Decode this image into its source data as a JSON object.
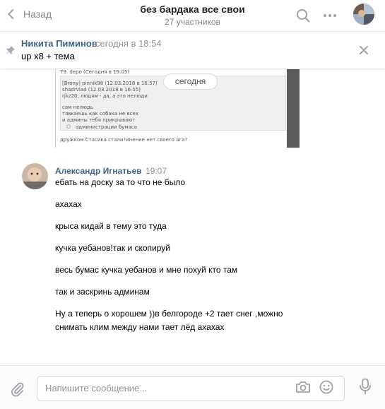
{
  "header": {
    "back_label": "Назад",
    "title": "без бардака все свои",
    "subtitle": "27 участников"
  },
  "pinned": {
    "author": "Никита Пиминов",
    "time": "сегодня в 18:54",
    "text": "up x8 + тема"
  },
  "attachment": {
    "lines": [
      "79. depo (Сегодня в 19:05)",
      "[Brony] pinnik98 (12.03.2018 в 16:57)",
      "shadrvlad (12.03.2018 в 16:55)",
      "rjkz20, людям - да, а это нелюди",
      "сам нелюдь",
      "тявкаешь как собака не всех",
      "и админы тебя прикрывают",
      "администрации бумаса",
      "дружком Стасика стали?инение нет своего ага?"
    ]
  },
  "date_divider": "сегодня",
  "message": {
    "author": "Александр Игнатьев",
    "time": "19:07",
    "lines": [
      "ебать на доску за то что не было",
      "ахахах",
      "крыса кидай в тему это туда",
      "кучка уебанов!так и скопируй",
      "весь бумас кучка уебанов и мне похуй кто там",
      "так и заскринь админам",
      "Ну а теперь о хорошем ))в белгороде +2 тает снег ,можно",
      "снимать клим между нами тает лёд ахахах"
    ]
  },
  "composer": {
    "placeholder": "Напишите сообщение..."
  },
  "icons": {
    "back": "chevron-left-icon",
    "search": "search-icon",
    "more": "more-icon",
    "pin": "pin-icon",
    "close": "close-icon",
    "attach": "paperclip-icon",
    "camera": "camera-icon",
    "smile": "smile-icon",
    "mic": "microphone-icon"
  },
  "colors": {
    "accent": "#42648b",
    "muted": "#939393",
    "icon": "#99a2ad"
  }
}
